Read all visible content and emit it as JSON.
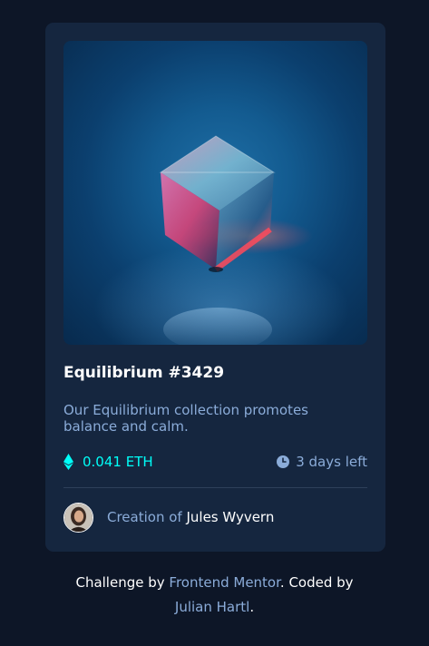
{
  "card": {
    "image_alt": "Equilibrium image",
    "title": "Equilibrium #3429",
    "description": "Our Equilibrium collection promotes balance and calm.",
    "price": "0.041 ETH",
    "time_left": "3 days left",
    "creator_prefix": "Creation of ",
    "creator_name": "Jules Wyvern",
    "icons": {
      "price": "ethereum-icon",
      "time": "clock-icon"
    }
  },
  "attribution": {
    "prefix": "Challenge by ",
    "link1": "Frontend Mentor",
    "middle": ". Coded by",
    "link2": "Julian Hartl",
    "suffix": "."
  },
  "colors": {
    "page_bg": "#0d1627",
    "card_bg": "#15263f",
    "accent_cyan": "#00fff8",
    "soft_blue": "#8bacd9",
    "white": "#ffffff"
  }
}
